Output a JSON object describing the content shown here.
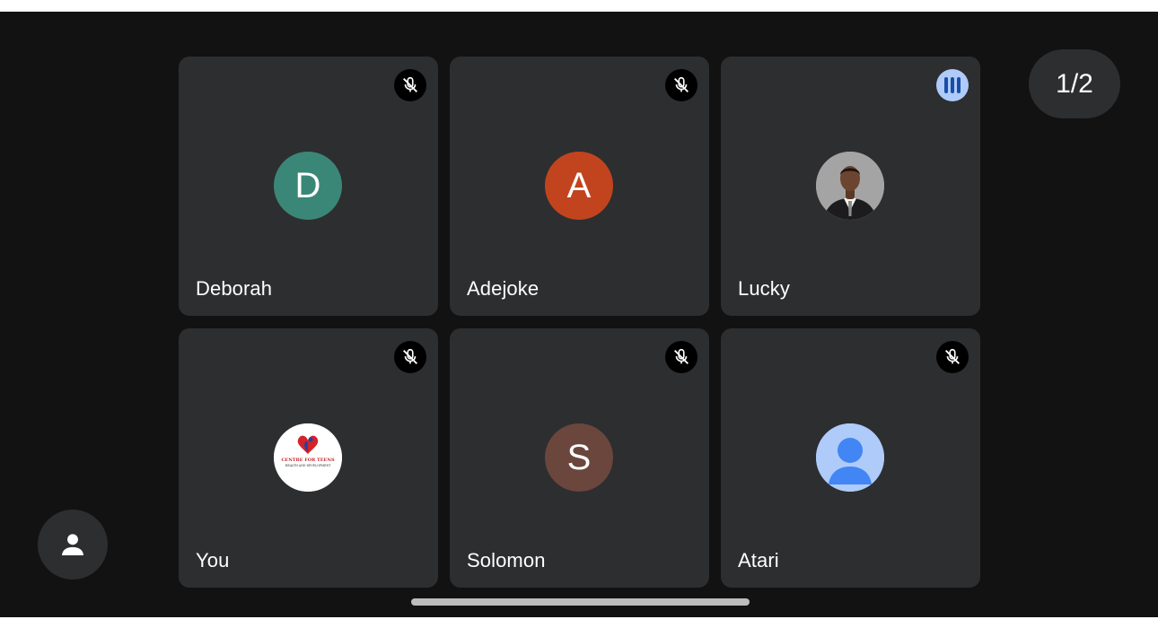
{
  "pager": {
    "label": "1/2"
  },
  "participants": [
    {
      "name": "Deborah",
      "initial": "D",
      "avatar_color": "#3b8777",
      "mic": "muted"
    },
    {
      "name": "Adejoke",
      "initial": "A",
      "avatar_color": "#c2441f",
      "mic": "muted"
    },
    {
      "name": "Lucky",
      "initial": "",
      "avatar_type": "photo",
      "mic": "speaking"
    },
    {
      "name": "You",
      "initial": "",
      "avatar_type": "logo",
      "logo_text": "CENTRE FOR TEENS",
      "logo_subtext": "HEALTH AND DEVELOPMENT",
      "mic": "muted"
    },
    {
      "name": "Solomon",
      "initial": "S",
      "avatar_color": "#6a463d",
      "mic": "muted"
    },
    {
      "name": "Atari",
      "initial": "",
      "avatar_type": "default-person",
      "mic": "muted"
    }
  ],
  "colors": {
    "background": "#121212",
    "tile": "#2d2e30",
    "speaking_badge": "#aecbfa",
    "speaking_bars": "#174ea6"
  }
}
